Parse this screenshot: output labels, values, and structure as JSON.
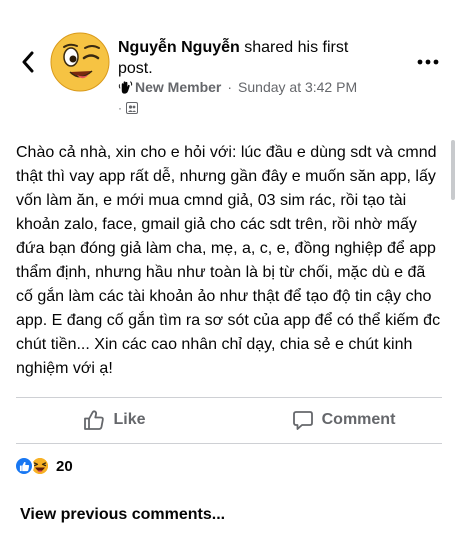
{
  "post": {
    "author": "Nguyễn Nguyễn",
    "action": " shared his first post.",
    "badge": "New Member",
    "separator": "·",
    "timestamp": "Sunday at 3:42 PM",
    "audience_dot": "·",
    "audience_icon": "group-audience-icon",
    "body": "Chào cả nhà, xin cho e hỏi với: lúc đầu e dùng sdt và cmnd thật thì vay app rất dễ, nhưng gần đây e muốn săn app, lấy vốn làm ăn, e mới mua cmnd giả, 03 sim rác, rồi tạo tài khoản zalo, face, gmail giả cho các sdt trên, rồi nhờ mấy đứa bạn đóng giả làm cha, mẹ, a, c, e, đồng nghiệp để app thẩm định, nhưng hầu như toàn là bị từ chối, mặc dù e đã cố gắn làm các tài khoản ảo như thật để tạo độ tin cậy cho app. E đang cố gắn tìm ra sơ sót của app để có thể kiếm đc chút tiền... Xin các cao nhân chỉ dạy, chia sẻ e chút kinh nghiệm với ạ!"
  },
  "actions": {
    "like_label": "Like",
    "comment_label": "Comment"
  },
  "reactions": {
    "count": "20",
    "types": [
      "like",
      "haha"
    ]
  },
  "comments": {
    "view_previous": "View previous comments..."
  },
  "colors": {
    "text": "#050505",
    "secondary": "#65676b",
    "like_blue": "#1877f2",
    "haha_yellow": "#f7b125",
    "divider": "#ced0d4"
  }
}
